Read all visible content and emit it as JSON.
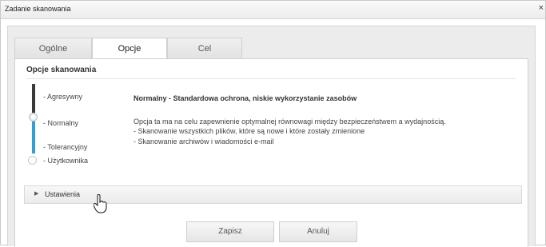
{
  "window": {
    "title": "Zadanie skanowania",
    "close_label": "×"
  },
  "tabs": [
    {
      "label": "Ogólne",
      "active": false
    },
    {
      "label": "Opcje",
      "active": true
    },
    {
      "label": "Cel",
      "active": false
    }
  ],
  "section": {
    "title": "Opcje skanowania"
  },
  "levels": [
    {
      "label": "- Agresywny"
    },
    {
      "label": "- Normalny"
    },
    {
      "label": "- Tolerancyjny"
    },
    {
      "label": "- Użytkownika"
    }
  ],
  "description": {
    "title": "Normalny - Standardowa ochrona, niskie wykorzystanie zasobów",
    "lines": [
      "Opcja ta ma na celu zapewnienie optymalnej równowagi między bezpieczeństwem a wydajnością.",
      "- Skanowanie wszystkich plików, które są nowe i które zostały zmienione",
      "- Skanowanie archiwów i wiadomości e-mail"
    ]
  },
  "settings": {
    "label": "Ustawienia",
    "arrow": "▶"
  },
  "buttons": {
    "save": "Zapisz",
    "cancel": "Anuluj"
  },
  "colors": {
    "slider_active": "#2f9fd8",
    "slider_dark": "#3a3a3a"
  }
}
